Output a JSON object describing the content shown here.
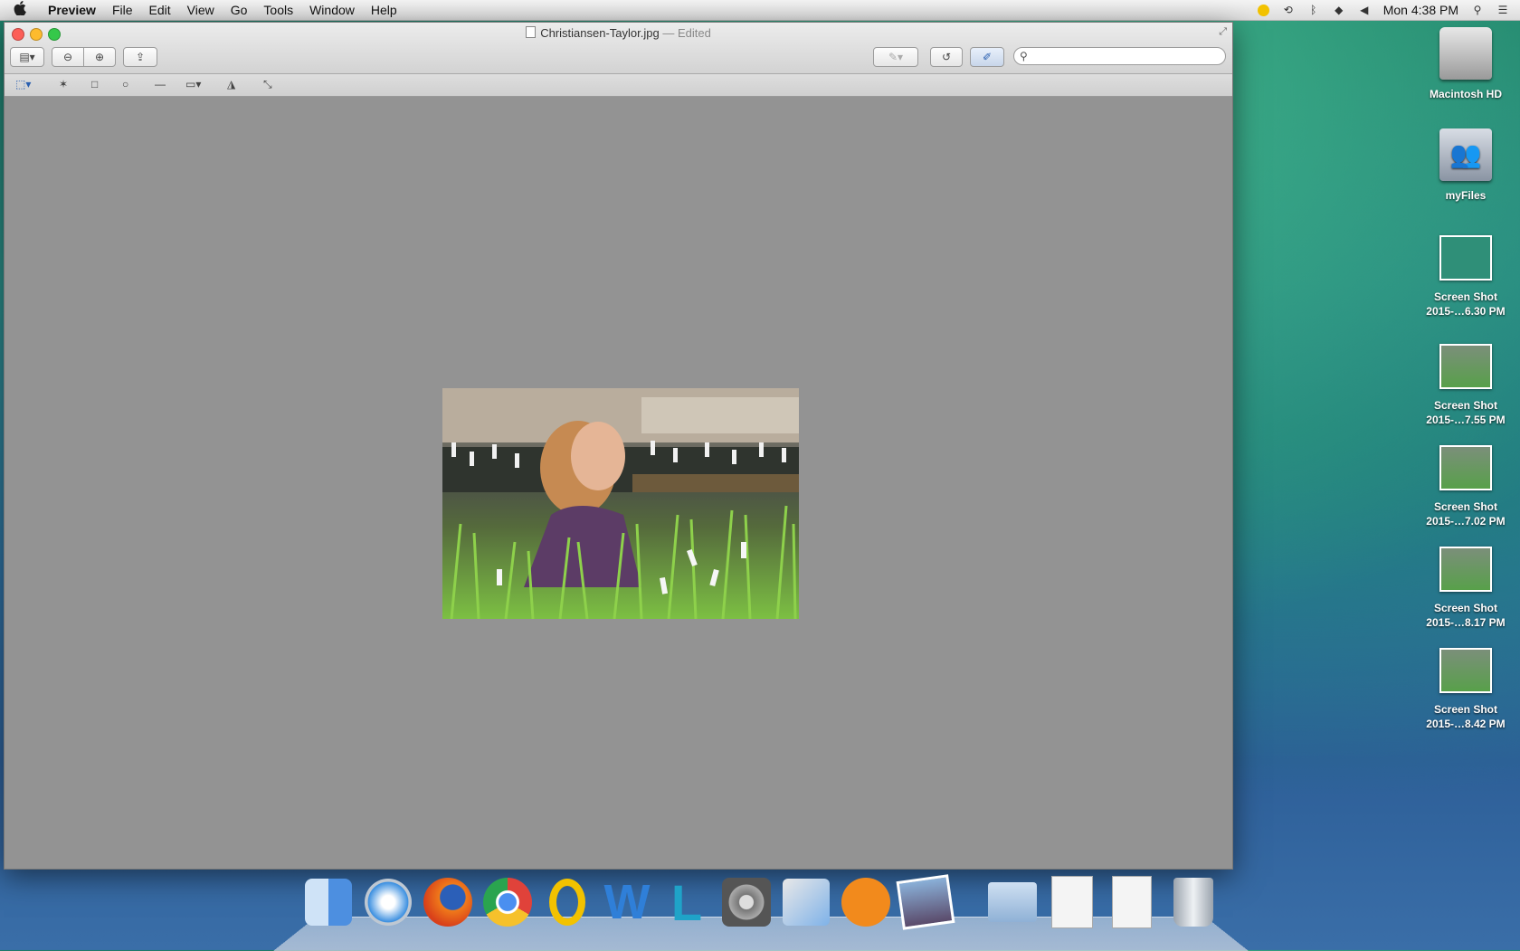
{
  "menubar": {
    "apple": "",
    "app_name": "Preview",
    "menus": [
      "File",
      "Edit",
      "View",
      "Go",
      "Tools",
      "Window",
      "Help"
    ],
    "clock": "Mon 4:38 PM"
  },
  "window": {
    "filename": "Christiansen-Taylor.jpg",
    "separator": " — ",
    "status": "Edited",
    "search_placeholder": ""
  },
  "desktop": {
    "items": [
      {
        "line1": "Macintosh HD",
        "line2": ""
      },
      {
        "line1": "myFiles",
        "line2": ""
      },
      {
        "line1": "Screen Shot",
        "line2": "2015-…6.30 PM"
      },
      {
        "line1": "Screen Shot",
        "line2": "2015-…7.55 PM"
      },
      {
        "line1": "Screen Shot",
        "line2": "2015-…7.02 PM"
      },
      {
        "line1": "Screen Shot",
        "line2": "2015-…8.17 PM"
      },
      {
        "line1": "Screen Shot",
        "line2": "2015-…8.42 PM"
      }
    ]
  },
  "dock": {
    "apps": [
      "finder-icon",
      "safari-icon",
      "firefox-icon",
      "chrome-icon",
      "outlook-icon",
      "word-icon",
      "lync-icon",
      "system-preferences-icon",
      "maps-icon",
      "ibooks-icon",
      "iphoto-preview-icon",
      "folder-stack-icon",
      "documents-stack-icon",
      "downloads-stack-icon",
      "trash-icon"
    ]
  },
  "colors": {
    "menubar_bg": "#e6e6e6",
    "window_bg": "#939393",
    "close": "#fc5e57",
    "minimize": "#fdbb2e",
    "maximize": "#35c84a"
  }
}
